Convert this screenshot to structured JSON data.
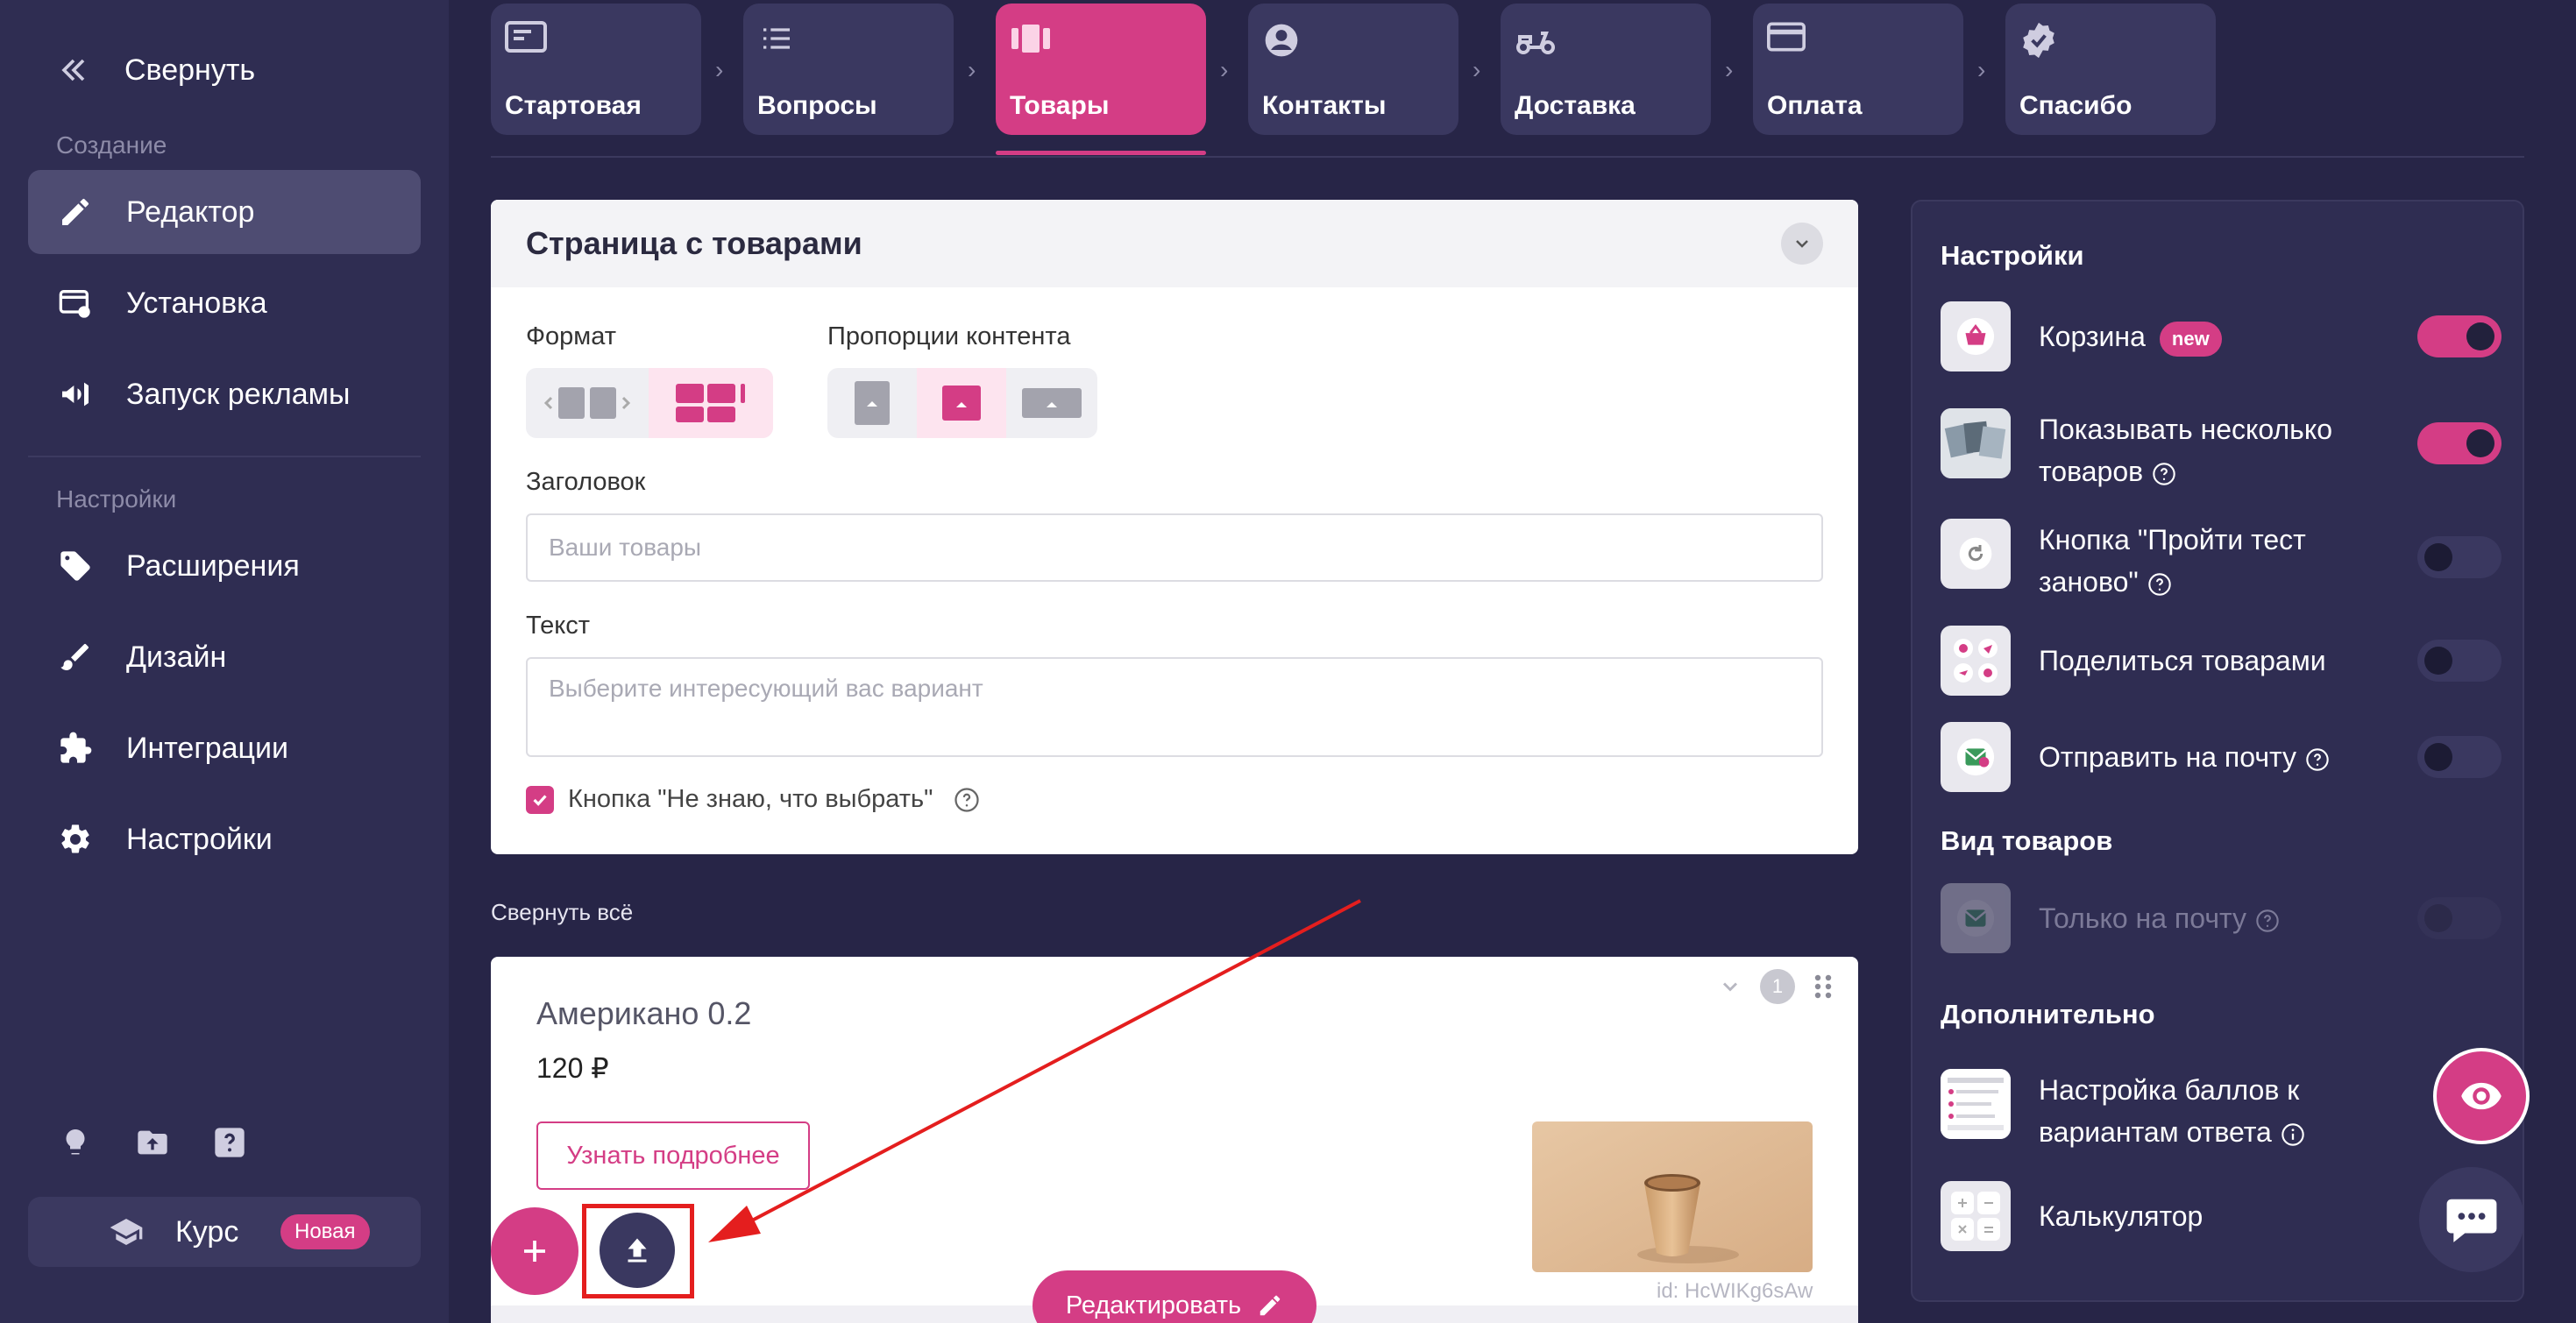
{
  "sidebar": {
    "collapse_label": "Свернуть",
    "section_create": "Создание",
    "section_settings": "Настройки",
    "items": [
      {
        "label": "Редактор",
        "icon": "pencil-icon",
        "active": true
      },
      {
        "label": "Установка",
        "icon": "install-icon",
        "active": false
      },
      {
        "label": "Запуск рекламы",
        "icon": "megaphone-icon",
        "active": false
      },
      {
        "label": "Расширения",
        "icon": "tag-plus-icon",
        "active": false
      },
      {
        "label": "Дизайн",
        "icon": "brush-icon",
        "active": false
      },
      {
        "label": "Интеграции",
        "icon": "puzzle-icon",
        "active": false
      },
      {
        "label": "Настройки",
        "icon": "gear-icon",
        "active": false
      }
    ],
    "bottom_icons": [
      "lightbulb-icon",
      "folder-upload-icon",
      "help-icon"
    ],
    "course": {
      "label": "Курс",
      "badge": "Новая",
      "icon": "graduation-cap-icon"
    }
  },
  "tabs": [
    {
      "label": "Стартовая",
      "icon": "start-page-icon",
      "active": false
    },
    {
      "label": "Вопросы",
      "icon": "list-icon",
      "active": false
    },
    {
      "label": "Товары",
      "icon": "carousel-icon",
      "active": true
    },
    {
      "label": "Контакты",
      "icon": "user-circle-icon",
      "active": false
    },
    {
      "label": "Доставка",
      "icon": "scooter-icon",
      "active": false
    },
    {
      "label": "Оплата",
      "icon": "credit-card-icon",
      "active": false
    },
    {
      "label": "Спасибо",
      "icon": "check-badge-icon",
      "active": false
    }
  ],
  "tab_separator": "›",
  "main": {
    "title": "Страница с товарами",
    "format_label": "Формат",
    "proportions_label": "Пропорции контента",
    "heading_label": "Заголовок",
    "heading_placeholder": "Ваши товары",
    "text_label": "Текст",
    "text_placeholder": "Выберите интересующий вас вариант",
    "dont_know_label": "Кнопка \"Не знаю, что выбрать\"",
    "dont_know_checked": true
  },
  "collapse_all": "Свернуть всё",
  "product": {
    "name": "Американо 0.2",
    "price": "120 ₽",
    "button": "Узнать подробнее",
    "id_text": "id: HcWIKg6sAw",
    "index": "1"
  },
  "edit_button": "Редактировать",
  "settings": {
    "heading": "Настройки",
    "items": [
      {
        "label": "Корзина",
        "badge": "new",
        "on": true
      },
      {
        "label": "Показывать несколько товаров",
        "on": true
      },
      {
        "label": "Кнопка \"Пройти тест заново\"",
        "on": false
      },
      {
        "label": "Поделиться товарами",
        "on": false
      },
      {
        "label": "Отправить на почту",
        "on": false
      }
    ],
    "view_heading": "Вид товаров",
    "view_items": [
      {
        "label": "Только на почту",
        "on": false,
        "disabled": true
      }
    ],
    "extra_heading": "Дополнительно",
    "extra_items": [
      {
        "label": "Настройка баллов к вариантам ответа"
      },
      {
        "label": "Калькулятор"
      }
    ]
  },
  "colors": {
    "background": "#272547",
    "sidebar": "#2f2d52",
    "accent": "#d43d85",
    "annotation": "#e41e1e"
  }
}
